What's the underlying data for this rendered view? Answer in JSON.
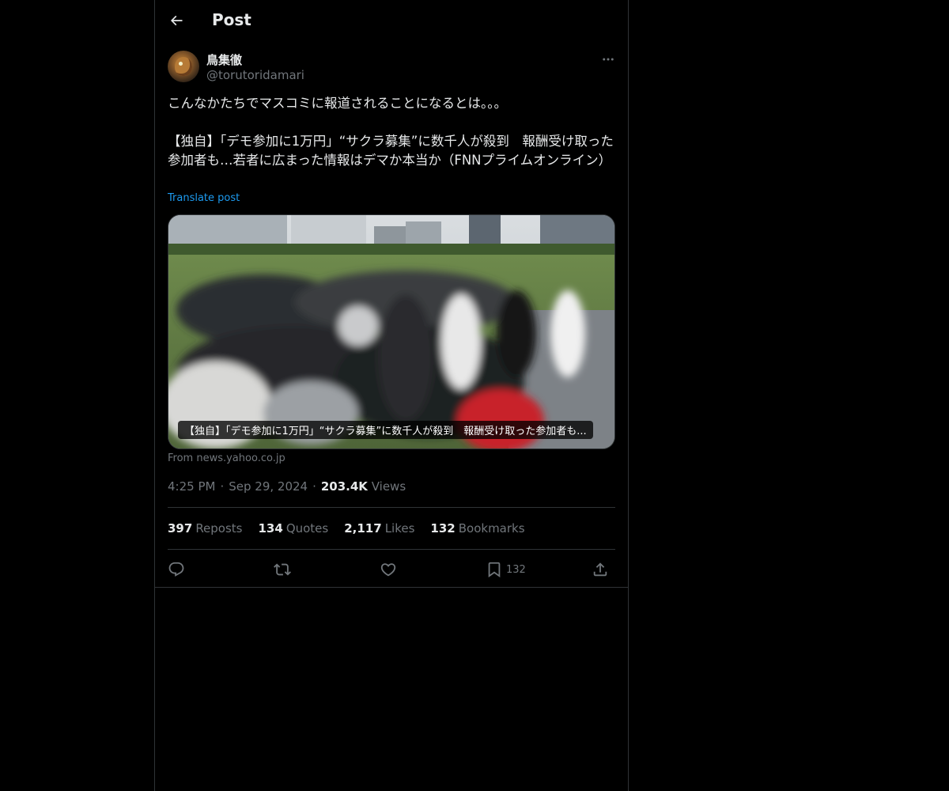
{
  "header": {
    "title": "Post"
  },
  "author": {
    "display_name": "鳥集徹",
    "handle": "@torutoridamari"
  },
  "post": {
    "text": "こんなかたちでマスコミに報道されることになるとは。。。\n\n【独自】「デモ参加に1万円」“サクラ募集”に数千人が殺到　報酬受け取った参加者も…若者に広まった情報はデマか本当か（FNNプライムオンライン）",
    "translate_label": "Translate post"
  },
  "card": {
    "caption": "【独自】「デモ参加に1万円」“サクラ募集”に数千人が殺到　報酬受け取った参加者も...",
    "source": "From news.yahoo.co.jp"
  },
  "meta": {
    "time": "4:25 PM",
    "date": "Sep 29, 2024",
    "views_count": "203.4K",
    "views_label": "Views",
    "separator": "·"
  },
  "stats": {
    "reposts_count": "397",
    "reposts_label": "Reposts",
    "quotes_count": "134",
    "quotes_label": "Quotes",
    "likes_count": "2,117",
    "likes_label": "Likes",
    "bookmarks_count": "132",
    "bookmarks_label": "Bookmarks"
  },
  "actions": {
    "reply_icon": "reply-icon",
    "repost_icon": "repost-icon",
    "like_icon": "heart-icon",
    "bookmark_icon": "bookmark-icon",
    "bookmark_count": "132",
    "share_icon": "share-icon"
  },
  "colors": {
    "background": "#000000",
    "text": "#e7e9ea",
    "secondary": "#71767b",
    "accent": "#1d9bf0",
    "border": "#2f3336"
  }
}
